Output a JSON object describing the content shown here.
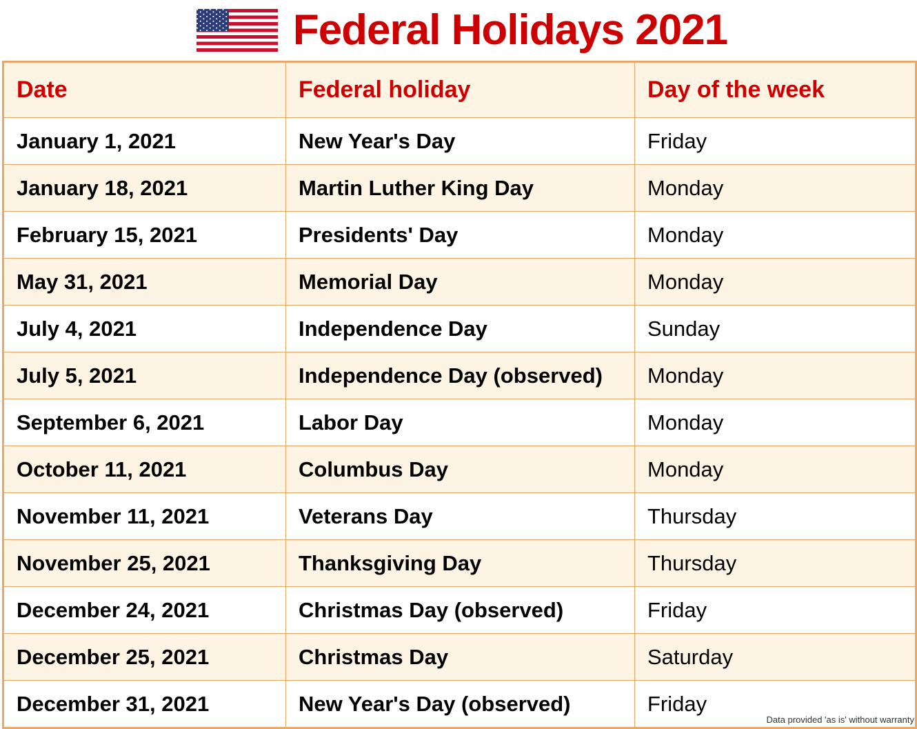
{
  "header": {
    "flag_icon": "us-flag-icon",
    "title": "Federal Holidays 2021"
  },
  "table": {
    "columns": [
      "Date",
      "Federal holiday",
      "Day of the week"
    ],
    "rows": [
      {
        "date": "January 1, 2021",
        "holiday": "New Year's Day",
        "day": "Friday"
      },
      {
        "date": "January 18, 2021",
        "holiday": "Martin Luther King Day",
        "day": "Monday"
      },
      {
        "date": "February 15, 2021",
        "holiday": "Presidents' Day",
        "day": "Monday"
      },
      {
        "date": "May 31, 2021",
        "holiday": "Memorial Day",
        "day": "Monday"
      },
      {
        "date": "July 4, 2021",
        "holiday": "Independence Day",
        "day": "Sunday"
      },
      {
        "date": "July 5, 2021",
        "holiday": "Independence Day (observed)",
        "day": "Monday"
      },
      {
        "date": "September 6, 2021",
        "holiday": "Labor Day",
        "day": "Monday"
      },
      {
        "date": "October 11, 2021",
        "holiday": "Columbus Day",
        "day": "Monday"
      },
      {
        "date": "November 11, 2021",
        "holiday": "Veterans Day",
        "day": "Thursday"
      },
      {
        "date": "November 25, 2021",
        "holiday": "Thanksgiving Day",
        "day": "Thursday"
      },
      {
        "date": "December 24, 2021",
        "holiday": "Christmas Day (observed)",
        "day": "Friday"
      },
      {
        "date": "December 25, 2021",
        "holiday": "Christmas Day",
        "day": "Saturday"
      },
      {
        "date": "December 31, 2021",
        "holiday": "New Year's Day (observed)",
        "day": "Friday"
      }
    ]
  },
  "footnote": "Data provided 'as is' without warranty",
  "colors": {
    "accent_red": "#cc0000",
    "border_orange": "#e6a96a",
    "row_cream": "#fdf4e4",
    "row_white": "#ffffff",
    "text_black": "#000000"
  }
}
